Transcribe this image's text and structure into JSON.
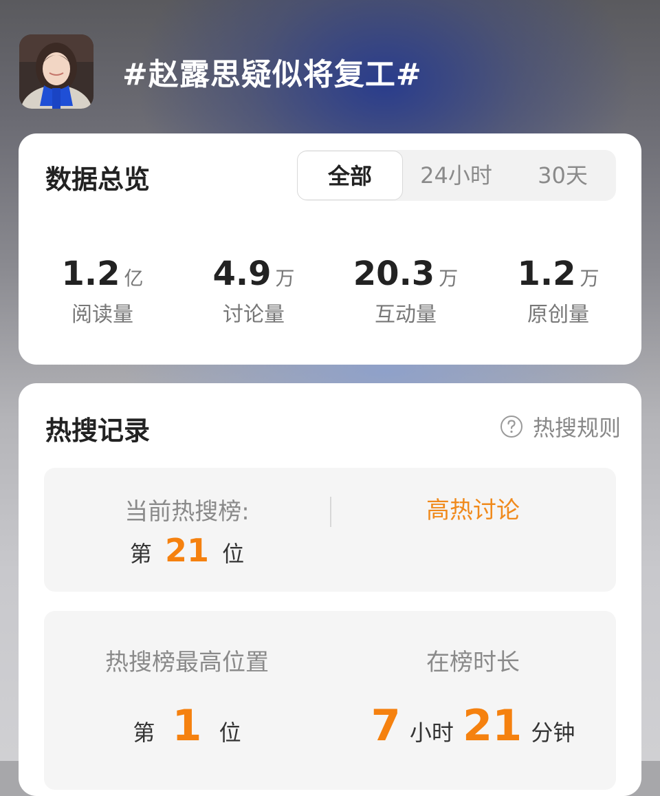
{
  "topic": {
    "title": "#赵露思疑似将复工#"
  },
  "overview": {
    "title": "数据总览",
    "tabs": [
      {
        "label": "全部",
        "active": true
      },
      {
        "label": "24小时",
        "active": false
      },
      {
        "label": "30天",
        "active": false
      }
    ],
    "stats": [
      {
        "value": "1.2",
        "unit": "亿",
        "label": "阅读量"
      },
      {
        "value": "4.9",
        "unit": "万",
        "label": "讨论量"
      },
      {
        "value": "20.3",
        "unit": "万",
        "label": "互动量"
      },
      {
        "value": "1.2",
        "unit": "万",
        "label": "原创量"
      }
    ]
  },
  "hot_search": {
    "title": "热搜记录",
    "rules_label": "热搜规则",
    "current": {
      "label": "当前热搜榜:",
      "prefix": "第",
      "rank": "21",
      "suffix": "位",
      "tag": "高热讨论"
    },
    "best": {
      "label": "热搜榜最高位置",
      "prefix": "第",
      "rank": "1",
      "suffix": "位"
    },
    "duration": {
      "label": "在榜时长",
      "hours": "7",
      "hours_unit": "小时",
      "minutes": "21",
      "minutes_unit": "分钟"
    }
  },
  "colors": {
    "accent": "#f5810f",
    "card_bg": "#ffffff",
    "panel_bg": "#f5f5f5"
  }
}
